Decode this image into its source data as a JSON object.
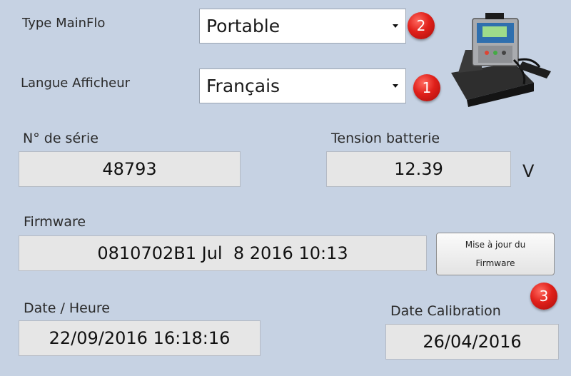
{
  "type_mainflo": {
    "label": "Type MainFlo",
    "value": "Portable"
  },
  "langue_afficheur": {
    "label": "Langue Afficheur",
    "value": "Français"
  },
  "serial": {
    "label": "N° de série",
    "value": "48793"
  },
  "battery": {
    "label": "Tension batterie",
    "value": "12.39",
    "unit": "V"
  },
  "firmware": {
    "label": "Firmware",
    "value": "0810702B1 Jul  8 2016 10:13",
    "update_button": {
      "line1": "Mise à jour du",
      "line2": "Firmware"
    }
  },
  "datetime": {
    "label": "Date / Heure",
    "value": "22/09/2016 16:18:16"
  },
  "calibration": {
    "label": "Date Calibration",
    "value": "26/04/2016"
  },
  "badges": [
    "2",
    "1",
    "3"
  ],
  "icons": {
    "device": "portable-flow-meter-icon"
  },
  "colors": {
    "background": "#c6d2e3",
    "badge": "#e0201a",
    "readonly_field": "#e6e6e6"
  }
}
